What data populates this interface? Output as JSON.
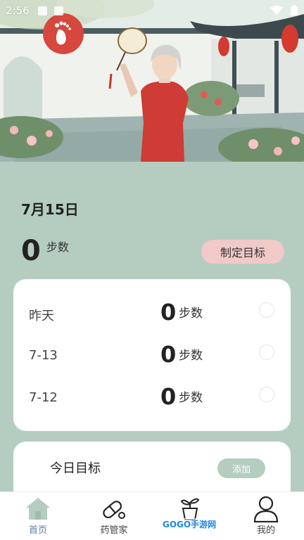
{
  "status_bar": {
    "time": "2:56"
  },
  "main": {
    "date": "7月15日",
    "today_steps": "0",
    "steps_unit": "步数",
    "set_goal_label": "制定目标"
  },
  "history": [
    {
      "label": "昨天",
      "steps": "0",
      "unit": "步数"
    },
    {
      "label": "7-13",
      "steps": "0",
      "unit": "步数"
    },
    {
      "label": "7-12",
      "steps": "0",
      "unit": "步数"
    }
  ],
  "goal_card": {
    "title": "今日目标",
    "add_label": "添加"
  },
  "nav": [
    {
      "label": "首页",
      "icon": "home-icon",
      "active": true
    },
    {
      "label": "药管家",
      "icon": "pill-icon",
      "active": false
    },
    {
      "label": "",
      "icon": "plant-icon",
      "active": false
    },
    {
      "label": "我的",
      "icon": "user-icon",
      "active": false
    }
  ],
  "watermark": "GOGO手游网",
  "colors": {
    "background": "#b4cdc0",
    "goal_button": "#f1c9c9",
    "logo_red": "#d6473d",
    "nav_active": "#5c7ea6"
  }
}
